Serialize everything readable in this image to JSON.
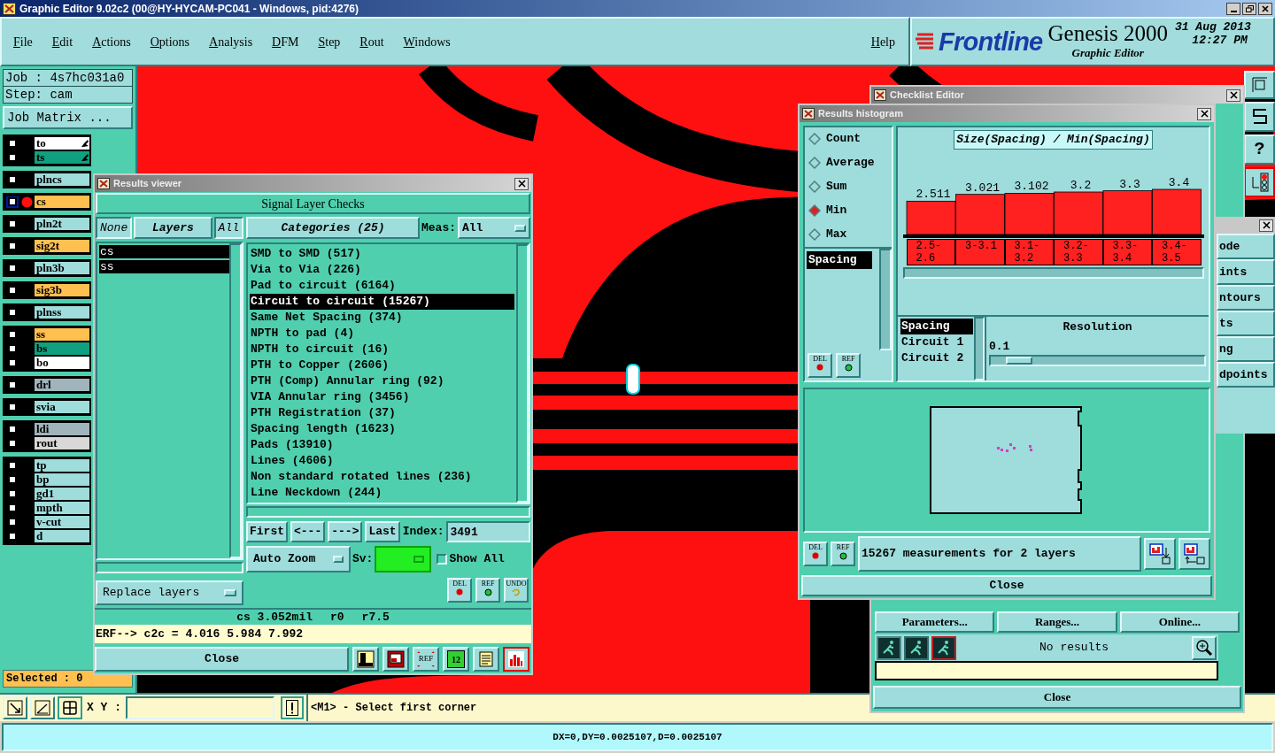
{
  "window": {
    "title": "Graphic Editor 9.02c2 (00@HY-HYCAM-PC041 - Windows, pid:4276)"
  },
  "menu": [
    "File",
    "Edit",
    "Actions",
    "Options",
    "Analysis",
    "DFM",
    "Step",
    "Rout",
    "Windows"
  ],
  "help_menu": "Help",
  "brand": {
    "logo": "Frontline",
    "product": "Genesis 2000",
    "subtitle": "Graphic Editor",
    "date": "31 Aug 2013",
    "time": "12:27 PM"
  },
  "job": {
    "job": "Job : 4s7hc031a0",
    "step": "Step: cam",
    "matrix_button": "Job Matrix ..."
  },
  "layer_groups": [
    {
      "layers": [
        {
          "name": "to",
          "color": "#ffffff",
          "selected": false,
          "edit_icon": true
        },
        {
          "name": "ts",
          "color": "#10a080",
          "selected": false,
          "edit_icon": true
        }
      ]
    },
    {
      "layers": [
        {
          "name": "plncs",
          "color": "#9fdcdc",
          "selected": false,
          "edit_icon": false
        }
      ]
    },
    {
      "layers": [
        {
          "name": "cs",
          "color": "#ffc050",
          "selected": true,
          "edit_icon": false
        }
      ]
    },
    {
      "layers": [
        {
          "name": "pln2t",
          "color": "#9fdcdc",
          "selected": false,
          "edit_icon": false
        }
      ]
    },
    {
      "layers": [
        {
          "name": "sig2t",
          "color": "#ffc050",
          "selected": false,
          "edit_icon": false
        }
      ]
    },
    {
      "layers": [
        {
          "name": "pln3b",
          "color": "#9fdcdc",
          "selected": false,
          "edit_icon": false
        }
      ]
    },
    {
      "layers": [
        {
          "name": "sig3b",
          "color": "#ffc050",
          "selected": false,
          "edit_icon": false
        }
      ]
    },
    {
      "layers": [
        {
          "name": "plnss",
          "color": "#9fdcdc",
          "selected": false,
          "edit_icon": false
        }
      ]
    },
    {
      "layers": [
        {
          "name": "ss",
          "color": "#ffc050",
          "selected": false,
          "edit_icon": false
        },
        {
          "name": "bs",
          "color": "#10a080",
          "selected": false,
          "edit_icon": false
        },
        {
          "name": "bo",
          "color": "#ffffff",
          "selected": false,
          "edit_icon": false
        }
      ]
    },
    {
      "layers": [
        {
          "name": "drl",
          "color": "#a0b4bc",
          "selected": false,
          "edit_icon": false
        }
      ]
    },
    {
      "layers": [
        {
          "name": "svia",
          "color": "#9fdcdc",
          "selected": false,
          "edit_icon": false
        }
      ]
    },
    {
      "layers": [
        {
          "name": "ldi",
          "color": "#a0b4bc",
          "selected": false,
          "edit_icon": false
        },
        {
          "name": "rout",
          "color": "#d8d8d8",
          "selected": false,
          "edit_icon": false
        }
      ]
    },
    {
      "layers": [
        {
          "name": "tp",
          "color": "#9fdcdc",
          "selected": false,
          "edit_icon": false
        },
        {
          "name": "bp",
          "color": "#9fdcdc",
          "selected": false,
          "edit_icon": false
        },
        {
          "name": "gd1",
          "color": "#9fdcdc",
          "selected": false,
          "edit_icon": false
        },
        {
          "name": "mpth",
          "color": "#9fdcdc",
          "selected": false,
          "edit_icon": false
        },
        {
          "name": "v-cut",
          "color": "#9fdcdc",
          "selected": false,
          "edit_icon": false
        },
        {
          "name": "d",
          "color": "#9fdcdc",
          "selected": false,
          "edit_icon": false
        }
      ]
    }
  ],
  "selected_count": "Selected : 0",
  "results_viewer": {
    "title": "Results viewer",
    "heading": "Signal Layer Checks",
    "layer_tabs": [
      {
        "label": "None",
        "selected": false
      },
      {
        "label": "Layers",
        "selected": true
      },
      {
        "label": "All",
        "selected": false
      }
    ],
    "layers": [
      {
        "name": "cs",
        "selected": true
      },
      {
        "name": "ss",
        "selected": true
      }
    ],
    "categories_button": "Categories (25)",
    "meas_label": "Meas:",
    "meas_value": "All",
    "categories": [
      {
        "label": "SMD to SMD (517)",
        "selected": false
      },
      {
        "label": "Via to Via (226)",
        "selected": false
      },
      {
        "label": "Pad to circuit (6164)",
        "selected": false
      },
      {
        "label": "Circuit to circuit (15267)",
        "selected": true
      },
      {
        "label": "Same Net Spacing (374)",
        "selected": false
      },
      {
        "label": "NPTH to pad (4)",
        "selected": false
      },
      {
        "label": "NPTH to circuit (16)",
        "selected": false
      },
      {
        "label": "PTH to Copper (2606)",
        "selected": false
      },
      {
        "label": "PTH (Comp) Annular ring (92)",
        "selected": false
      },
      {
        "label": "VIA Annular ring (3456)",
        "selected": false
      },
      {
        "label": "PTH Registration (37)",
        "selected": false
      },
      {
        "label": "Spacing length (1623)",
        "selected": false
      },
      {
        "label": "Pads (13910)",
        "selected": false
      },
      {
        "label": "Lines (4606)",
        "selected": false
      },
      {
        "label": "Non standard rotated lines (236)",
        "selected": false
      },
      {
        "label": "Line Neckdown (244)",
        "selected": false
      }
    ],
    "nav": [
      "First",
      "<---",
      "--->",
      "Last"
    ],
    "index_label": "Index:",
    "index_value": "3491",
    "auto_zoom": "Auto Zoom",
    "sv_label": "Sv:",
    "show_all": {
      "label": "Show All",
      "checked": false
    },
    "replace": "Replace layers",
    "actions": [
      {
        "kind": "del",
        "label": "DEL"
      },
      {
        "kind": "ref",
        "label": "REF"
      },
      {
        "kind": "undo",
        "label": "UNDO"
      }
    ],
    "measure": [
      "cs 3.052mil",
      "r0",
      "r7.5"
    ],
    "erf": "ERF--> c2c = 4.016 5.984 7.992",
    "close": "Close",
    "tools": [
      {
        "kind": "person",
        "selected": false
      },
      {
        "kind": "monitor",
        "selected": false
      },
      {
        "kind": "noref",
        "label": "REF",
        "selected": false
      },
      {
        "kind": "numbers",
        "label": "12",
        "selected": false
      },
      {
        "kind": "report",
        "selected": false
      },
      {
        "kind": "histogram",
        "selected": true
      }
    ]
  },
  "histogram": {
    "title": "Results histogram",
    "modes": [
      {
        "label": "Count",
        "selected": false
      },
      {
        "label": "Average",
        "selected": false
      },
      {
        "label": "Sum",
        "selected": false
      },
      {
        "label": "Min",
        "selected": true
      },
      {
        "label": "Max",
        "selected": false
      }
    ],
    "attributes": [
      {
        "label": "Spacing",
        "selected": true
      }
    ],
    "actions": [
      {
        "kind": "del",
        "label": "DEL"
      },
      {
        "kind": "ref",
        "label": "REF"
      }
    ],
    "chart_data": {
      "type": "bar",
      "title": "Size(Spacing) / Min(Spacing)",
      "categories": [
        "2.5-2.6",
        "3-3.1",
        "3.1-3.2",
        "3.2-3.3",
        "3.3-3.4",
        "3.4-3.5"
      ],
      "series": [
        {
          "color": "#ff2020",
          "values": [
            2.511,
            3.021,
            3.102,
            3.2,
            3.3,
            3.4
          ]
        }
      ],
      "data_labels": true
    },
    "series_list": [
      {
        "label": "Spacing",
        "selected": true
      },
      {
        "label": "Circuit 1",
        "selected": false
      },
      {
        "label": "Circuit 2",
        "selected": false
      }
    ],
    "resolution_label": "Resolution",
    "resolution_value": "0.1",
    "resolution": {
      "level": 0.07
    },
    "bottom_actions": [
      {
        "kind": "del",
        "label": "DEL"
      },
      {
        "kind": "ref",
        "label": "REF"
      }
    ],
    "summary": "15267 measurements for 2 layers",
    "close": "Close"
  },
  "checklist_editor": {
    "title": "Checklist Editor",
    "buttons": [
      "Parameters...",
      "Ranges...",
      "Online..."
    ],
    "tools": [
      {
        "kind": "run"
      },
      {
        "kind": "run_line"
      },
      {
        "kind": "run_frame"
      }
    ],
    "status": "No results",
    "close": "Close"
  },
  "side_window": {
    "items": [
      "ode",
      "ints",
      "ntours",
      "ts",
      "ng",
      "dpoints"
    ]
  },
  "right_toolbar": {
    "help": "?"
  },
  "command_bar": {
    "xy_label": "X Y :",
    "message": "<M1> - Select first corner"
  },
  "status_bar": "DX=0,DY=0.0025107,D=0.0025107"
}
